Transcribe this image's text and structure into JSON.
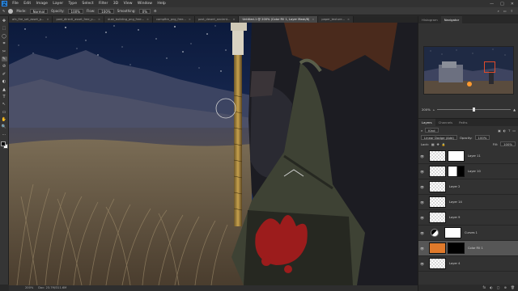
{
  "menubar": {
    "logo": "Ps",
    "items": [
      "File",
      "Edit",
      "Image",
      "Layer",
      "Type",
      "Select",
      "Filter",
      "3D",
      "View",
      "Window",
      "Help"
    ],
    "controls": [
      "—",
      "□",
      "✕"
    ]
  },
  "options": {
    "mode_label": "Mode:",
    "mode_value": "Normal",
    "opacity_label": "Opacity:",
    "opacity_value": "100%",
    "flow_label": "Flow:",
    "flow_value": "100%",
    "smoothing_label": "Smoothing:",
    "smoothing_value": "0%"
  },
  "tabs": [
    {
      "label": "afx_fire_set_asset_p...",
      "active": false
    },
    {
      "label": "post_directi_asset_free_p...",
      "active": false
    },
    {
      "label": "dust_building_png_free...",
      "active": false
    },
    {
      "label": "campfire_png_free...",
      "active": false
    },
    {
      "label": "post_desert_ancient...",
      "active": false
    },
    {
      "label": "Untitled-1 @ 200% (Color Fill 1, Layer Mask/8)",
      "active": true
    },
    {
      "label": "paper_texture...",
      "active": false
    }
  ],
  "toolbar": {
    "tools": [
      "✥",
      "⬚",
      "◯",
      "⌗",
      "✂",
      "✎",
      "⊘",
      "✐",
      "◐",
      "▲",
      "T",
      "↖",
      "▭",
      "✋",
      "🔍",
      "⋯"
    ],
    "active_index": 5,
    "foreground_color": "#000000",
    "background_color": "#ffffff"
  },
  "status": {
    "zoom": "200%",
    "doc_info": "Doc: 23.7M/311.6M"
  },
  "panels": {
    "top_tabs": [
      "Histogram",
      "Navigator"
    ],
    "top_active": 1,
    "nav_zoom": "200%",
    "layer_tabs": [
      "Layers",
      "Channels",
      "Paths"
    ],
    "layer_active": 0,
    "filter_kind": "Kind",
    "blend_mode": "Linear Dodge (Add)",
    "opacity_label": "Opacity:",
    "opacity_value": "100%",
    "fill_label": "Fill:",
    "fill_value": "100%",
    "lock_label": "Lock:",
    "footer_icons": [
      "fx",
      "◐",
      "▢",
      "⊕",
      "🗑"
    ]
  },
  "layers": [
    {
      "name": "Layer 11",
      "thumb": "checker",
      "mask": "white",
      "selected": false,
      "adjust": false
    },
    {
      "name": "Layer 10",
      "thumb": "checker",
      "mask": "mixed",
      "selected": false,
      "adjust": false
    },
    {
      "name": "Layer 2",
      "thumb": "checker",
      "mask": "",
      "selected": false,
      "adjust": false
    },
    {
      "name": "Layer 14",
      "thumb": "checker",
      "mask": "",
      "selected": false,
      "adjust": false
    },
    {
      "name": "Layer 9",
      "thumb": "checker",
      "mask": "",
      "selected": false,
      "adjust": false
    },
    {
      "name": "Curves 1",
      "thumb": "",
      "mask": "white",
      "selected": false,
      "adjust": true
    },
    {
      "name": "Color Fill 1",
      "thumb": "orange",
      "mask": "black",
      "selected": true,
      "adjust": false
    },
    {
      "name": "Layer 4",
      "thumb": "checker",
      "mask": "",
      "selected": false,
      "adjust": false
    }
  ]
}
